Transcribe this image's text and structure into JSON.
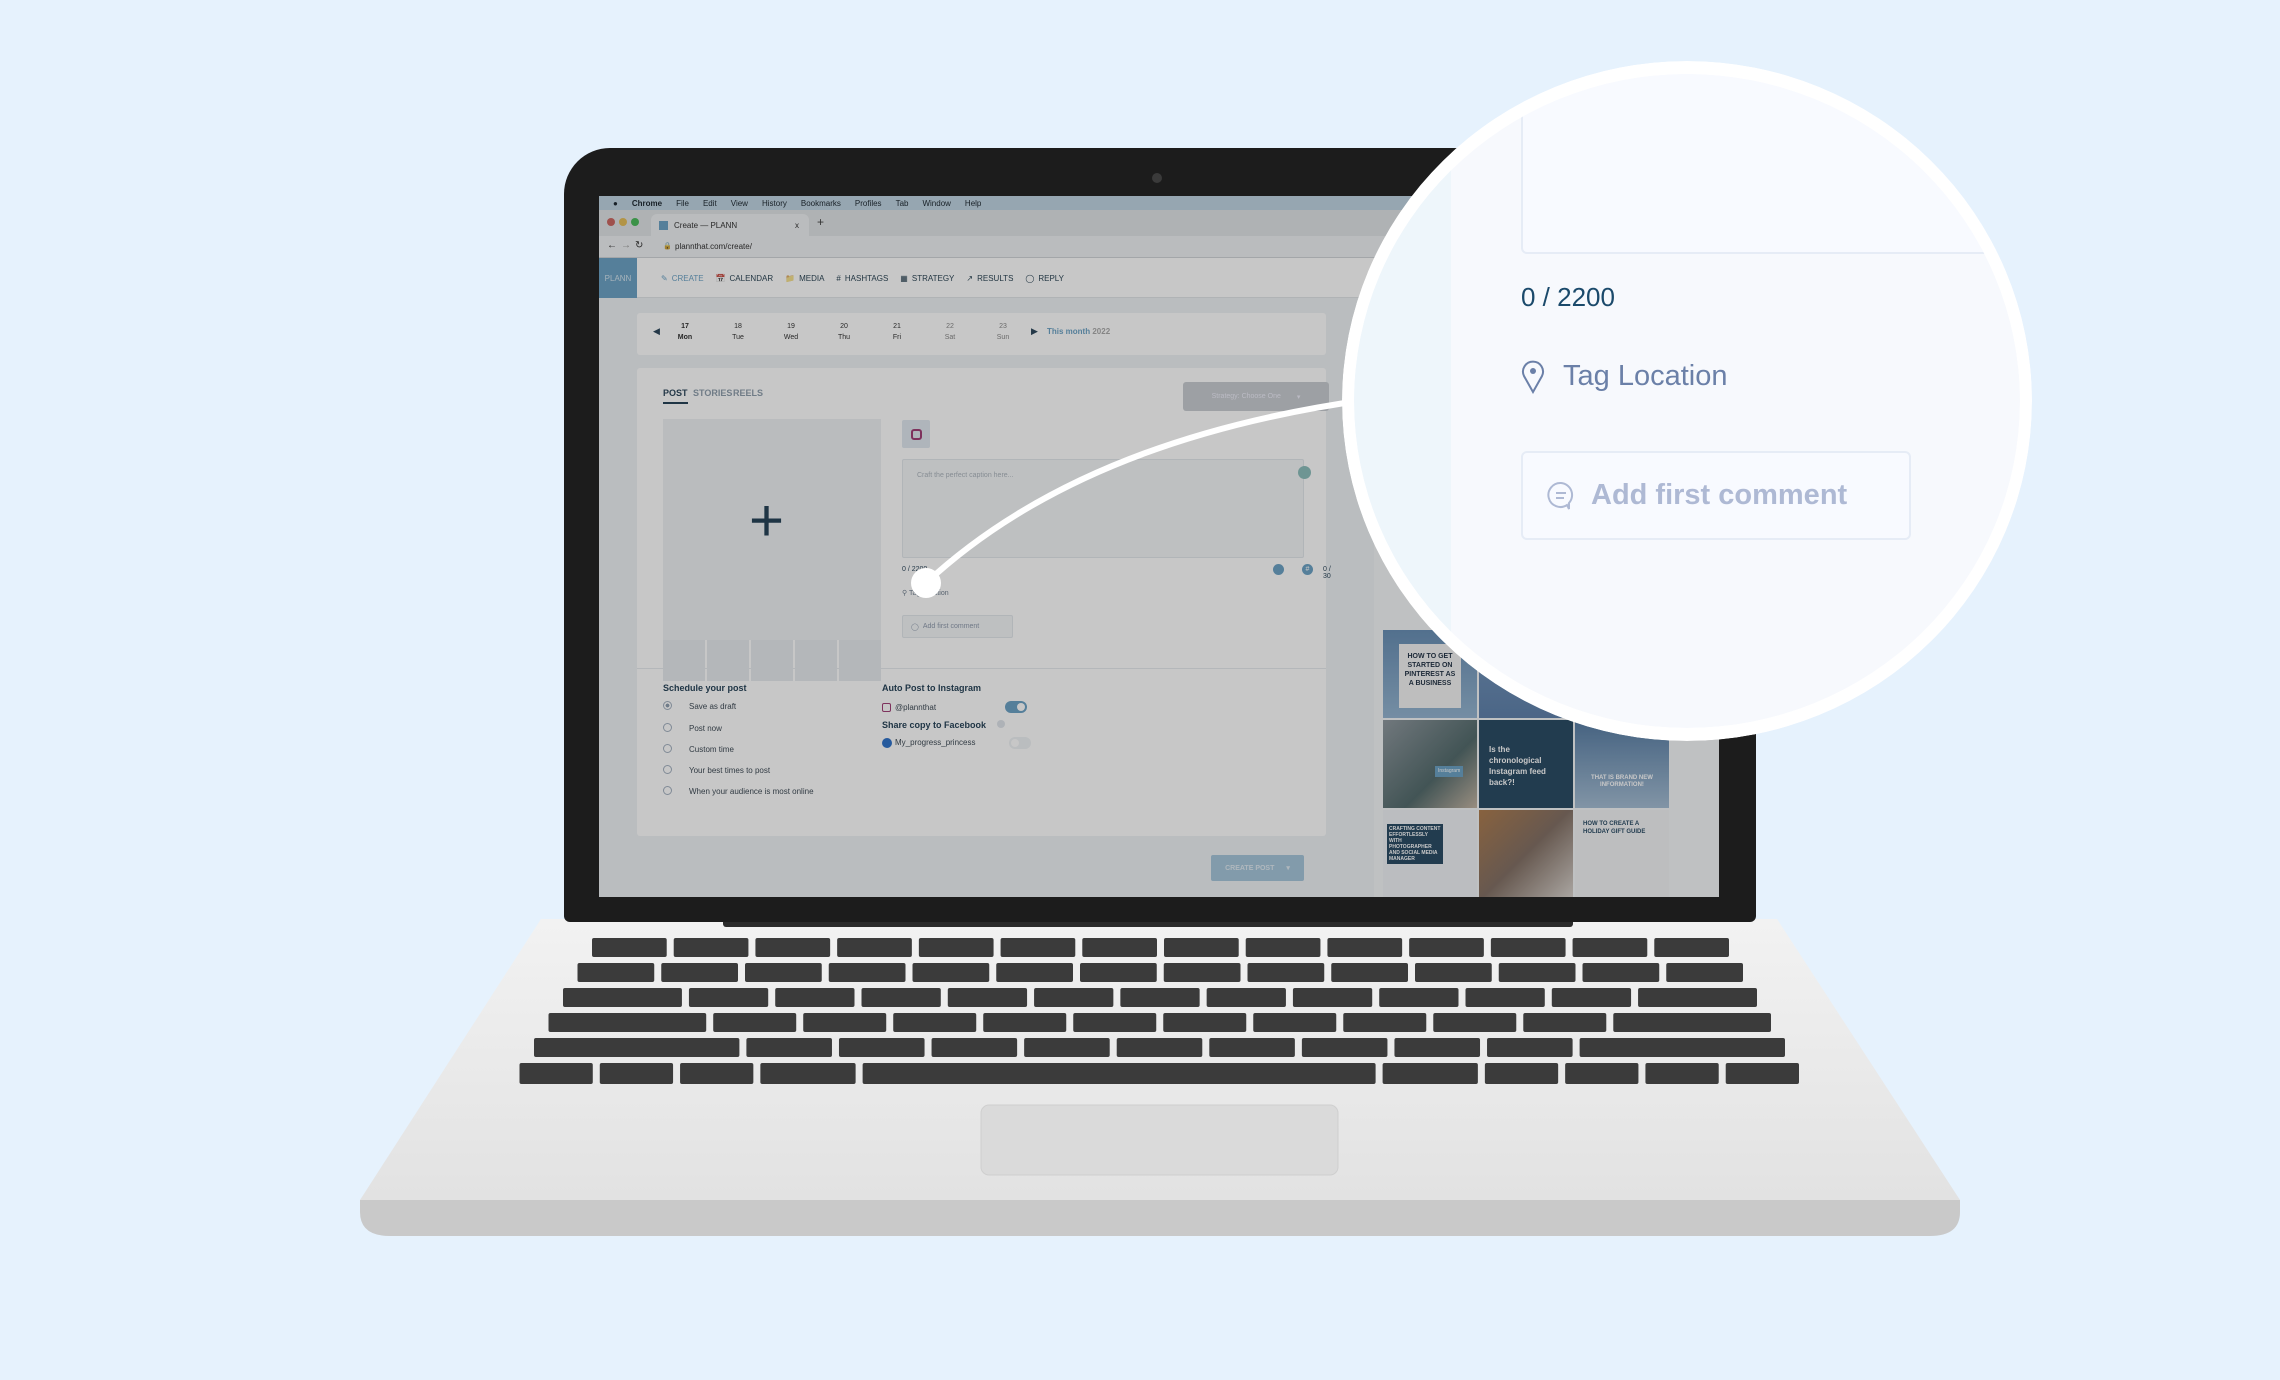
{
  "menubar": {
    "items": [
      "Chrome",
      "File",
      "Edit",
      "View",
      "History",
      "Bookmarks",
      "Profiles",
      "Tab",
      "Window",
      "Help"
    ]
  },
  "browser": {
    "tab_title": "Create — PLANN",
    "tab_close": "x",
    "new_tab": "+",
    "url": "plannthat.com/create/"
  },
  "app": {
    "logo": "PLANN",
    "nav": [
      "CREATE",
      "CALENDAR",
      "MEDIA",
      "HASHTAGS",
      "STRATEGY",
      "RESULTS",
      "REPLY"
    ]
  },
  "dates": {
    "days": [
      {
        "num": "17",
        "name": "Mon"
      },
      {
        "num": "18",
        "name": "Tue"
      },
      {
        "num": "19",
        "name": "Wed"
      },
      {
        "num": "20",
        "name": "Thu"
      },
      {
        "num": "21",
        "name": "Fri"
      },
      {
        "num": "22",
        "name": "Sat"
      },
      {
        "num": "23",
        "name": "Sun"
      }
    ],
    "this_month": "This month",
    "year": "2022"
  },
  "post": {
    "tabs": [
      "POST",
      "STORIES",
      "REELS"
    ],
    "strategy": "Strategy: Choose One",
    "caption_placeholder": "Craft the perfect caption here...",
    "char_count": "0 / 2200",
    "hashtag_count": "0 / 30",
    "tag_location": "Tag Location",
    "add_comment": "Add first comment"
  },
  "schedule": {
    "title": "Schedule your post",
    "options": [
      "Save as draft",
      "Post now",
      "Custom time",
      "Your best times to post",
      "When your audience is most online"
    ],
    "selected": 0
  },
  "autopost": {
    "title": "Auto Post to Instagram",
    "account": "@plannthat",
    "enabled": true
  },
  "facebook": {
    "title": "Share copy to Facebook",
    "account": "My_progress_princess",
    "enabled": false
  },
  "create_button": "CREATE POST",
  "grid": {
    "tiles": [
      "HOW TO GET STARTED ON PINTEREST AS A BUSINESS",
      "",
      "",
      "Instagram",
      "Is the chronological Instagram feed back?!",
      "THAT IS BRAND NEW INFORMATION!",
      "CRAFTING CONTENT EFFORTLESSLY WITH PHOTOGRAPHER AND SOCIAL MEDIA MANAGER",
      "",
      "HOW TO CREATE A HOLIDAY GIFT GUIDE"
    ]
  },
  "magnifier": {
    "char_count": "0 / 2200",
    "tag_location": "Tag Location",
    "add_comment": "Add first comment"
  },
  "colors": {
    "background": "#e6f2fd",
    "accent": "#5aa7d8",
    "text_dark": "#1e4664"
  }
}
